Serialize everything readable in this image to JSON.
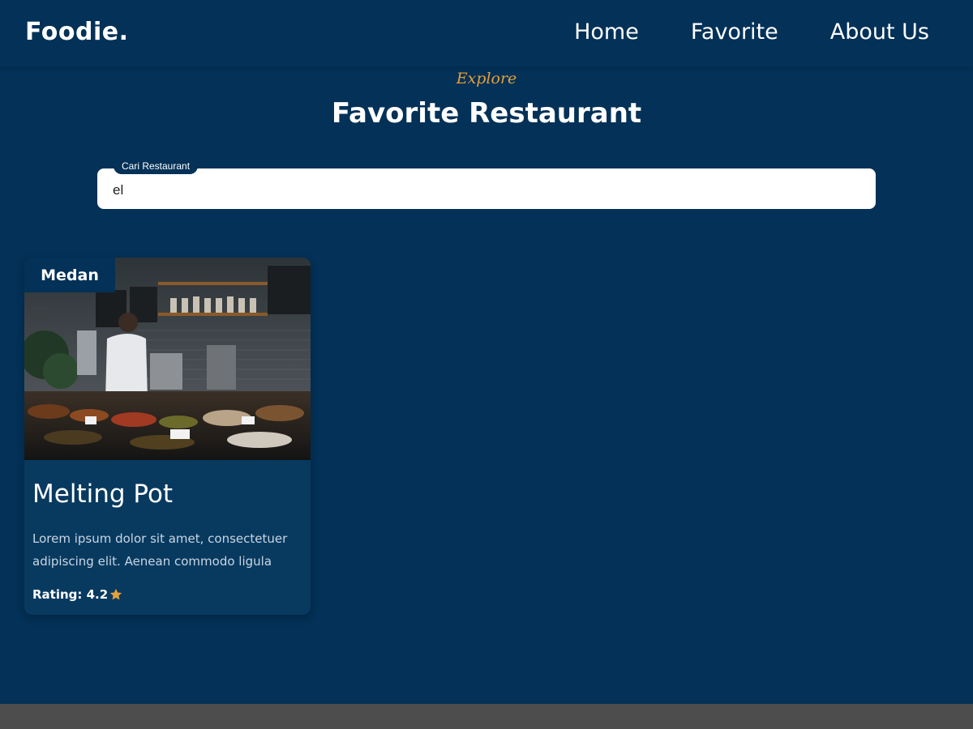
{
  "header": {
    "logo": "Foodie.",
    "nav": [
      {
        "label": "Home"
      },
      {
        "label": "Favorite"
      },
      {
        "label": "About Us"
      }
    ]
  },
  "hero": {
    "kicker": "Explore",
    "title": "Favorite Restaurant"
  },
  "search": {
    "label": "Cari Restaurant",
    "value": "el"
  },
  "restaurants": [
    {
      "city": "Medan",
      "name": "Melting Pot",
      "description": "Lorem ipsum dolor sit amet, consectetuer adipiscing elit. Aenean commodo ligula",
      "rating_text": "Rating: 4.2",
      "rating": 4.2,
      "rating_icon": "star-icon",
      "image": "restaurant kitchen counter photo"
    }
  ],
  "colors": {
    "background": "#033157",
    "accent": "#e4a03d",
    "card": "#083a60",
    "footer": "#4d4d4d"
  }
}
